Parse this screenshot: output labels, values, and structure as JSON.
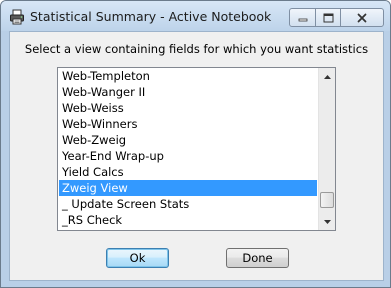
{
  "window": {
    "title": "Statistical Summary - Active Notebook",
    "icon": "printer-icon"
  },
  "caption_buttons": {
    "minimize_icon": "minimize-icon",
    "maximize_icon": "maximize-icon",
    "close_icon": "close-icon"
  },
  "dialog": {
    "prompt": "Select a view containing fields for which you want statistics"
  },
  "list": {
    "items": [
      "Web-Templeton",
      "Web-Wanger II",
      "Web-Weiss",
      "Web-Winners",
      "Web-Zweig",
      "Year-End Wrap-up",
      "Yield Calcs",
      "Zweig View",
      "_ Update Screen Stats",
      "_RS Check"
    ],
    "selected": "Zweig View",
    "selection_color": "#3399ff"
  },
  "buttons": {
    "ok_label": "Ok",
    "done_label": "Done"
  }
}
